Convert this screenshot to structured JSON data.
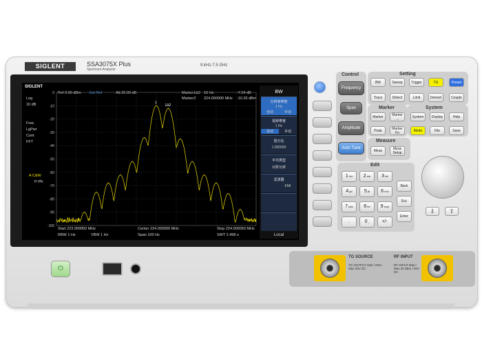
{
  "brand": {
    "logo": "SIGLENT",
    "model": "SSA3075X Plus",
    "subtitle": "Spectrum Analyzer",
    "freq_range": "9 kHz-7.5 GHz"
  },
  "screen": {
    "logo": "SIGLENT",
    "ref": "Ref  0.00 dBm",
    "ext_ref": "Ext Ref",
    "att": "Att  20.00 dB",
    "marker1_label": "Marker1Δ2",
    "marker1_freq": "10 Hz",
    "marker1_val": "-7.24 dB",
    "marker2_label": "Marker2",
    "marker2_freq": "224.000000 MHz",
    "marker2_val": "-10.26 dBm",
    "left_labels": [
      "Log",
      "10 dB",
      "Free",
      "LgPwr",
      "Cont",
      "FFT"
    ],
    "trace_a": "A  C&W",
    "trace_b": "P-PK",
    "y_ticks": [
      "0",
      "-10",
      "-20",
      "-30",
      "-40",
      "-50",
      "-60",
      "-70",
      "-80",
      "-90",
      "-100"
    ],
    "marker_tag_2": "2",
    "marker_tag_1d2": "1Δ2",
    "start": "Start  223.999950 MHz",
    "center": "Center  224.000000 MHz",
    "stop": "Stop  224.000050 MHz",
    "rbw": "RBW  1 Hz",
    "vbw": "VBW  1 Hz",
    "span": "Span     100 Hz",
    "swt": "SWT  2.498 s",
    "local": "Local",
    "softkeys": {
      "title": "BW",
      "k1_label": "分辨率带宽",
      "k1_value": "1 Hz",
      "k1_auto": "自动",
      "k1_man": "手动",
      "k2_label": "视频带宽",
      "k2_value": "1 Hz",
      "k2_auto": "自动",
      "k2_man": "手动",
      "k3_label": "视分比",
      "k3_value": "1.000000",
      "k4_label": "平均类型",
      "k4_value": "对数功率",
      "k5_label": "滤波器",
      "k5_a": "",
      "k5_b": "EMI"
    }
  },
  "control": {
    "title": "Control",
    "frequency": "Frequency",
    "span": "Span",
    "amplitude": "Amplitude",
    "auto_tune": "Auto Tune"
  },
  "setting": {
    "title": "Setting",
    "bw": "BW",
    "sweep": "Sweep",
    "trigger": "Trigger",
    "tg": "TG",
    "preset": "Preset",
    "trace": "Trace",
    "detect": "Detect",
    "limit": "Limit",
    "demod": "Demod",
    "couple": "Couple"
  },
  "marker": {
    "title": "Marker",
    "marker": "Marker",
    "marker_arrow": "Marker →",
    "peak": "Peak",
    "marker_fn": "Marker Fn"
  },
  "system": {
    "title": "System",
    "system": "System",
    "display": "Display",
    "help": "Help",
    "mode": "Mode",
    "file": "File",
    "save": "Save"
  },
  "measure": {
    "title": "Measure",
    "meas": "Meas",
    "meas_setup": "Meas Setup"
  },
  "edit": {
    "title": "Edit",
    "keys": [
      "1",
      "2",
      "3",
      "4",
      "5",
      "6",
      "7",
      "8",
      "9",
      ".",
      "0",
      "+/-"
    ],
    "subs": [
      "A/a",
      "abc",
      "def",
      "ghi",
      "jkl",
      "mno",
      "pqrs",
      "tuv",
      "wxyz",
      "",
      "_",
      ""
    ],
    "back": "Back",
    "esc": "Esc",
    "enter": "Enter"
  },
  "connectors": {
    "tg_title": "TG SOURCE",
    "tg_note": "TG OUTPUT 50Ω / REV. Max 30V DC",
    "rf_title": "RF INPUT",
    "rf_note": "RF INPUT 50Ω / Max 30 dBm / 50V DC"
  },
  "colors": {
    "trace": "#f0e000",
    "softkey_active": "#2d6cc0",
    "tg_button": "#f4f000",
    "preset_button": "#2f6fe0",
    "mode_button": "#f4f200",
    "auto_tune": "#4d8ddc",
    "connector_frame": "#f2c200"
  },
  "chart_data": {
    "type": "line",
    "title": "",
    "xlabel": "",
    "ylabel": "",
    "xlim": [
      223.99995,
      224.00005
    ],
    "ylim": [
      -100,
      0
    ],
    "x_unit": "MHz",
    "y_unit": "dBm",
    "grid": true,
    "series": [
      {
        "peaks_x": [
          223.999964,
          223.99997,
          223.999976,
          223.999982,
          223.999988,
          223.999994,
          224.0,
          224.000006,
          224.000012,
          224.000018,
          224.000024,
          224.00003,
          224.000036,
          224.000042
        ],
        "peaks_y": [
          -90,
          -75,
          -68,
          -62,
          -52,
          -34,
          -10,
          -12,
          -35,
          -52,
          -62,
          -68,
          -76,
          -88
        ],
        "noise_floor": -96
      }
    ]
  }
}
